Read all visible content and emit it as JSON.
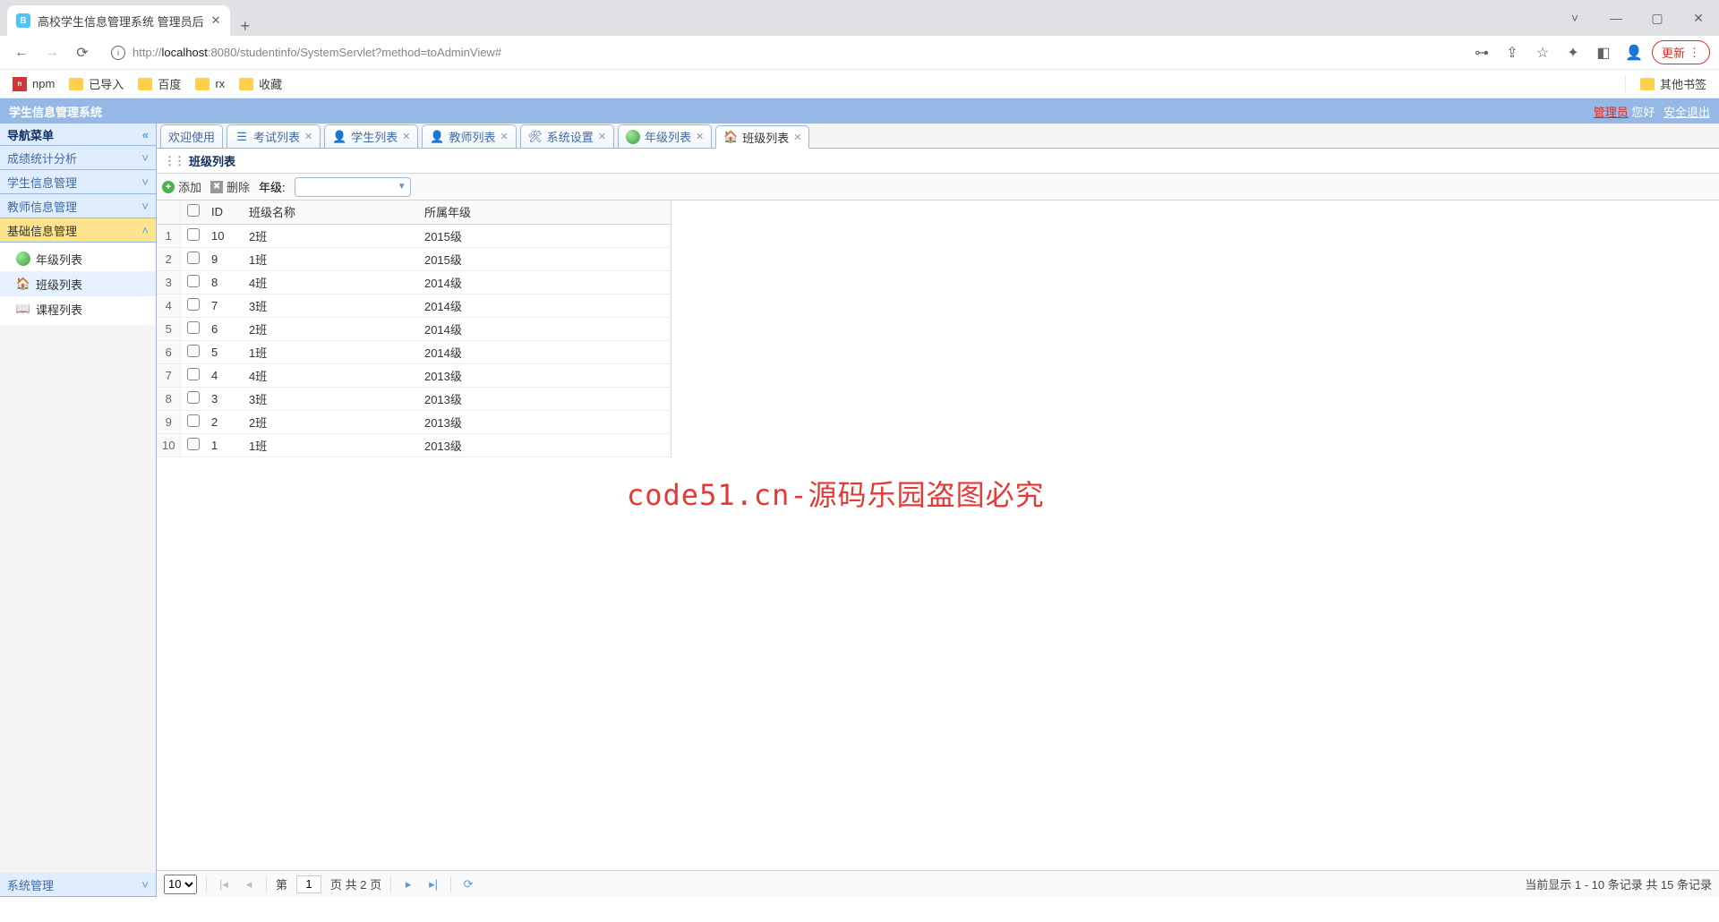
{
  "browser": {
    "tab_title": "高校学生信息管理系统 管理员后",
    "url_pre": "http://",
    "url_host": "localhost",
    "url_path": ":8080/studentinfo/SystemServlet?method=toAdminView#",
    "update_btn": "更新",
    "bookmarks": [
      "npm",
      "已导入",
      "百度",
      "rx",
      "收藏"
    ],
    "other_bm": "其他书签"
  },
  "header": {
    "title": "学生信息管理系统",
    "admin": "管理员",
    "greet": " 您好",
    "logout": "安全退出"
  },
  "nav": {
    "title": "导航菜单",
    "items": [
      "成绩统计分析",
      "学生信息管理",
      "教师信息管理",
      "基础信息管理"
    ],
    "tree": [
      "年级列表",
      "班级列表",
      "课程列表"
    ],
    "bottom": "系统管理"
  },
  "tabs": [
    "欢迎使用",
    "考试列表",
    "学生列表",
    "教师列表",
    "系统设置",
    "年级列表",
    "班级列表"
  ],
  "panel_title": "班级列表",
  "toolbar": {
    "add": "添加",
    "del": "删除",
    "grade_label": "年级:"
  },
  "columns": {
    "id": "ID",
    "name": "班级名称",
    "grade": "所属年级"
  },
  "rows": [
    {
      "n": "1",
      "id": "10",
      "name": "2班",
      "grade": "2015级"
    },
    {
      "n": "2",
      "id": "9",
      "name": "1班",
      "grade": "2015级"
    },
    {
      "n": "3",
      "id": "8",
      "name": "4班",
      "grade": "2014级"
    },
    {
      "n": "4",
      "id": "7",
      "name": "3班",
      "grade": "2014级"
    },
    {
      "n": "5",
      "id": "6",
      "name": "2班",
      "grade": "2014级"
    },
    {
      "n": "6",
      "id": "5",
      "name": "1班",
      "grade": "2014级"
    },
    {
      "n": "7",
      "id": "4",
      "name": "4班",
      "grade": "2013级"
    },
    {
      "n": "8",
      "id": "3",
      "name": "3班",
      "grade": "2013级"
    },
    {
      "n": "9",
      "id": "2",
      "name": "2班",
      "grade": "2013级"
    },
    {
      "n": "10",
      "id": "1",
      "name": "1班",
      "grade": "2013级"
    }
  ],
  "pager": {
    "size": "10",
    "page_pre": "第",
    "page": "1",
    "page_mid": "页 共 2 页",
    "info": "当前显示 1 - 10 条记录 共 15 条记录"
  },
  "watermark": "code51.cn-源码乐园盗图必究"
}
